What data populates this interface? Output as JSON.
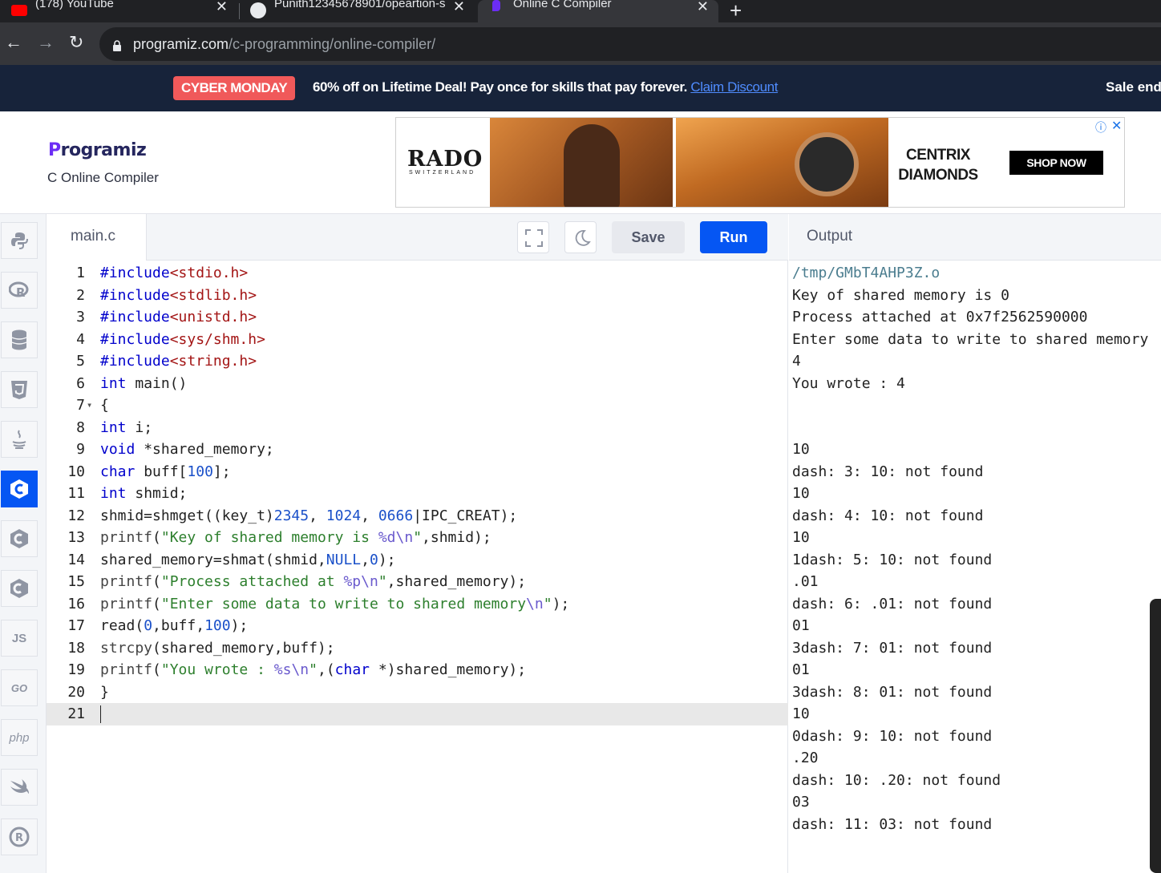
{
  "browser": {
    "tabs": [
      {
        "title": "(178) YouTube",
        "close": "✕"
      },
      {
        "title": "Punith12345678901/opeartion-s",
        "close": "✕"
      },
      {
        "title": "Online C Compiler",
        "close": "✕"
      }
    ],
    "new_tab": "+",
    "url_host": "programiz.com",
    "url_path": "/c-programming/online-compiler/"
  },
  "promo": {
    "badge": "CYBER MONDAY",
    "text": "60% off on Lifetime Deal! Pay once for skills that pay forever. ",
    "link": "Claim Discount",
    "right": "Sale end"
  },
  "header": {
    "logo": "rogramiz",
    "logo_mark": "P",
    "subtitle": "C Online Compiler"
  },
  "ad": {
    "brand": "RADO",
    "brand_sub": "SWITZERLAND",
    "partner": "CENTRIX DIAMONDS",
    "cta": "SHOP NOW",
    "info": "ⓘ",
    "close": "✕"
  },
  "sidebar": {
    "languages": [
      "python",
      "r",
      "sql",
      "html",
      "java",
      "c",
      "cpp",
      "csharp",
      "javascript",
      "go",
      "php",
      "swift",
      "rust"
    ],
    "labels": {
      "js": "JS",
      "go": "GO",
      "php": "php"
    }
  },
  "editor": {
    "filename": "main.c",
    "save_label": "Save",
    "run_label": "Run",
    "lines": [
      "#include<stdio.h>",
      "#include<stdlib.h>",
      "#include<unistd.h>",
      "#include<sys/shm.h>",
      "#include<string.h>",
      "int main()",
      "{",
      "int i;",
      "void *shared_memory;",
      "char buff[100];",
      "int shmid;",
      "shmid=shmget((key_t)2345, 1024, 0666|IPC_CREAT);",
      "printf(\"Key of shared memory is %d\\n\",shmid);",
      "shared_memory=shmat(shmid,NULL,0);",
      "printf(\"Process attached at %p\\n\",shared_memory);",
      "printf(\"Enter some data to write to shared memory\\n\");",
      "read(0,buff,100);",
      "strcpy(shared_memory,buff);",
      "printf(\"You wrote : %s\\n\",(char *)shared_memory);",
      "}",
      ""
    ]
  },
  "output": {
    "title": "Output",
    "lines": [
      "/tmp/GMbT4AHP3Z.o",
      "Key of shared memory is 0",
      "Process attached at 0x7f2562590000",
      "Enter some data to write to shared memory",
      "4",
      "You wrote : 4",
      "",
      "",
      "10",
      "dash: 3: 10: not found",
      "10",
      "dash: 4: 10: not found",
      "10",
      "1dash: 5: 10: not found",
      ".01",
      "dash: 6: .01: not found",
      "01",
      "3dash: 7: 01: not found",
      "01",
      "3dash: 8: 01: not found",
      "10",
      "0dash: 9: 10: not found",
      ".20",
      "dash: 10: .20: not found",
      "03",
      "dash: 11: 03: not found"
    ]
  },
  "colors": {
    "keyword": "#0000cc",
    "string": "#2d7f2d",
    "include": "#a31515",
    "number": "#1a50c9",
    "accent": "#0556f3"
  }
}
